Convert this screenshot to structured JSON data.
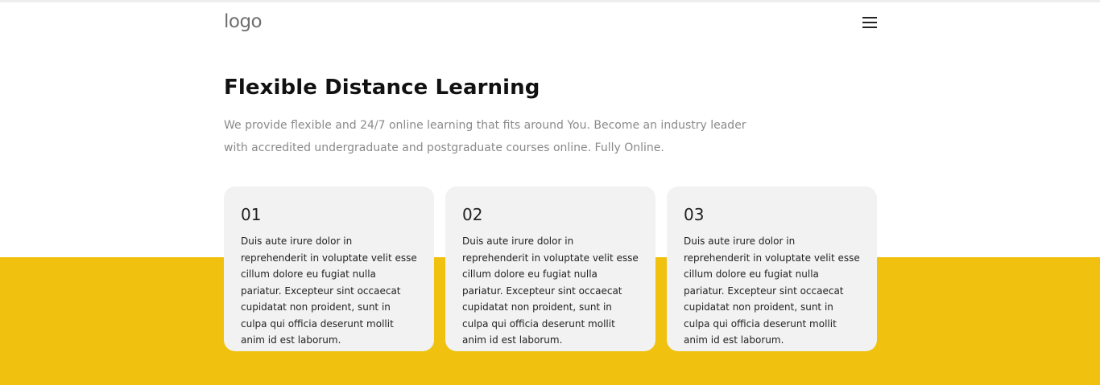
{
  "header": {
    "logo_text": "logo",
    "menu_icon": "hamburger-menu-icon"
  },
  "hero": {
    "title": "Flexible Distance Learning",
    "subtitle": "We provide flexible and 24/7 online learning that fits around You. Become an industry leader with accredited undergraduate and postgraduate courses online. Fully Online."
  },
  "cards": [
    {
      "number": "01",
      "text": "Duis aute irure dolor in reprehenderit in voluptate velit esse cillum dolore eu fugiat nulla pariatur. Excepteur sint occaecat cupidatat non proident, sunt in culpa qui officia deserunt mollit anim id est laborum."
    },
    {
      "number": "02",
      "text": "Duis aute irure dolor in reprehenderit in voluptate velit esse cillum dolore eu fugiat nulla pariatur. Excepteur sint occaecat cupidatat non proident, sunt in culpa qui officia deserunt mollit anim id est laborum."
    },
    {
      "number": "03",
      "text": "Duis aute irure dolor in reprehenderit in voluptate velit esse cillum dolore eu fugiat nulla pariatur. Excepteur sint occaecat cupidatat non proident, sunt in culpa qui officia deserunt mollit anim id est laborum."
    }
  ],
  "colors": {
    "accent": "#f0c20f",
    "card_background": "#f2f2f2",
    "subtitle_text": "#8a8a8a"
  }
}
